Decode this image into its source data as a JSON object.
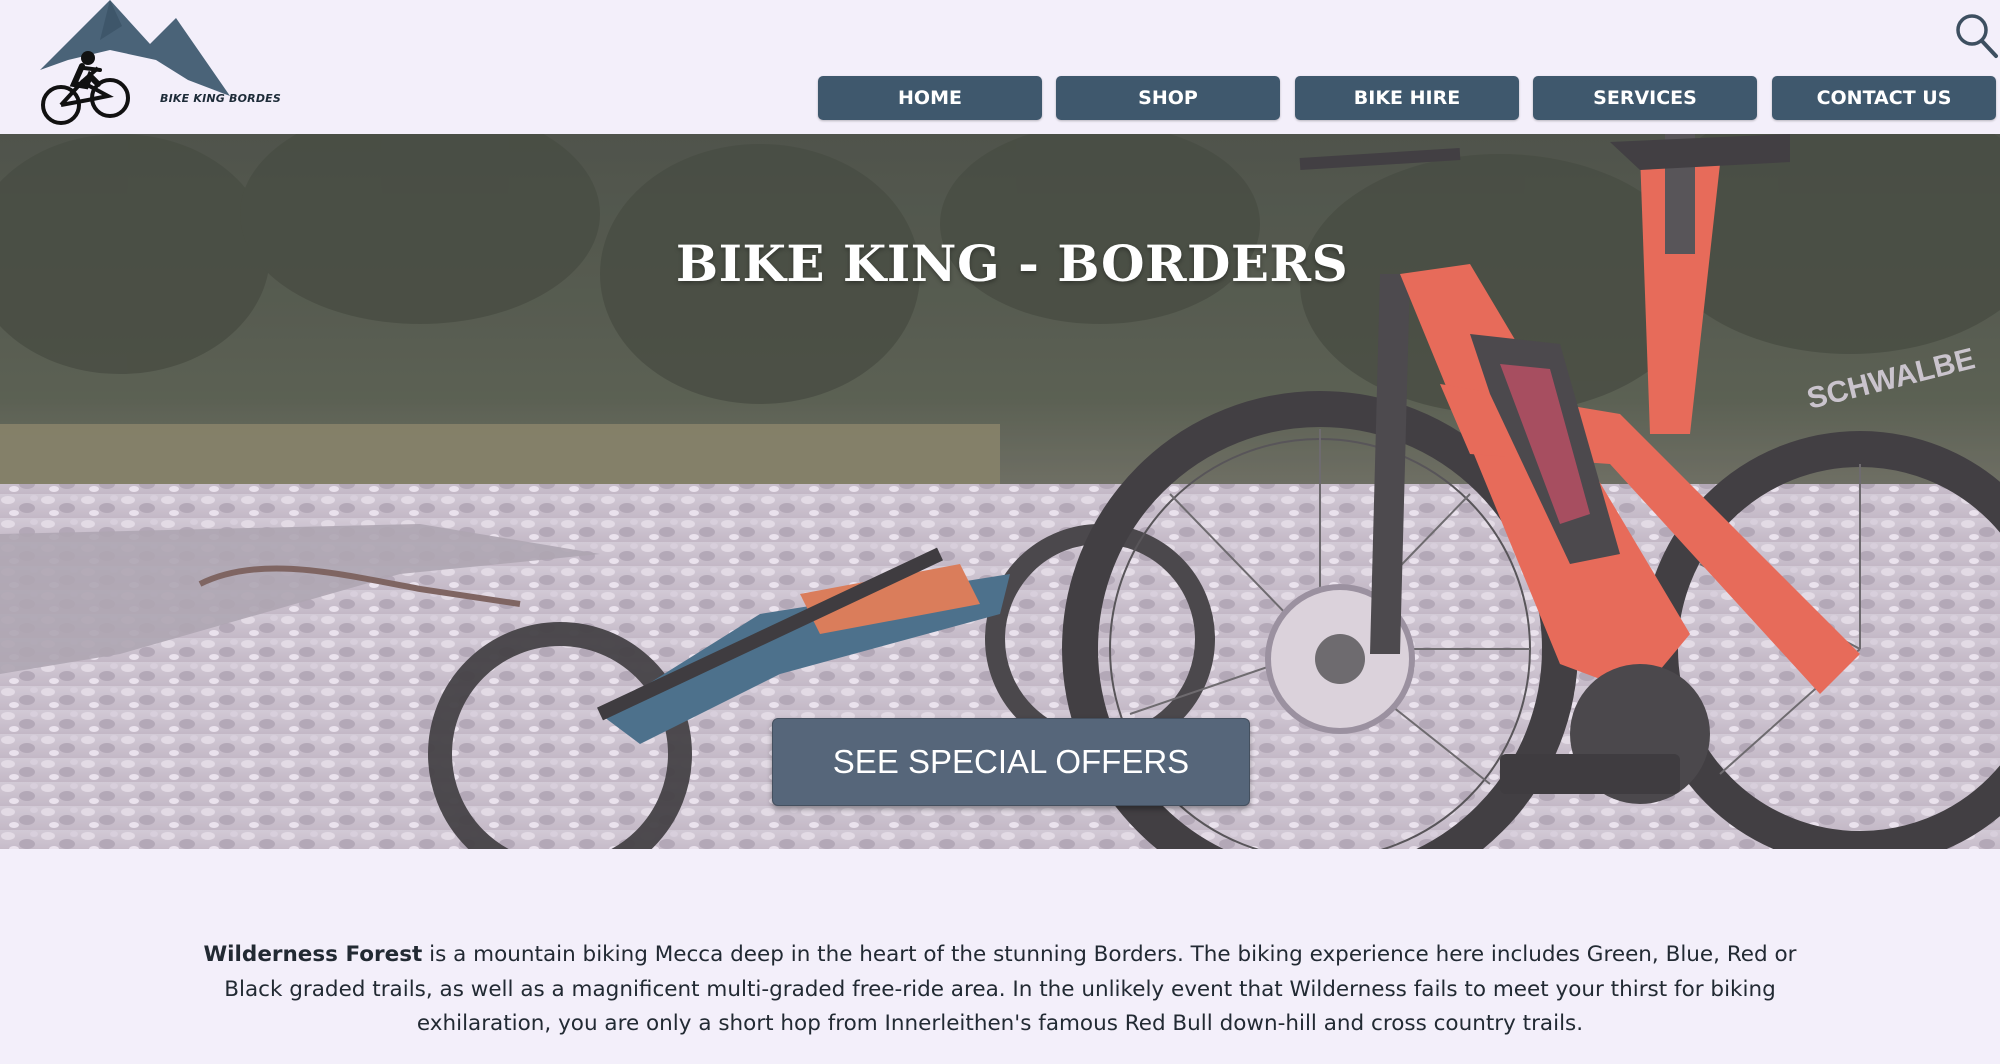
{
  "header": {
    "logo_text": "BIKE KING BORDES",
    "search_icon": "search-icon"
  },
  "nav": {
    "items": [
      {
        "label": "HOME"
      },
      {
        "label": "SHOP"
      },
      {
        "label": "BIKE HIRE"
      },
      {
        "label": "SERVICES"
      },
      {
        "label": "CONTACT US"
      }
    ]
  },
  "hero": {
    "title": "BIKE KING - BORDERS",
    "cta_label": "SEE SPECIAL OFFERS",
    "bike_brand_text": "SCHWALBE"
  },
  "intro": {
    "bold_lead": "Wilderness Forest",
    "text": " is a mountain biking Mecca deep in the heart of the stunning Borders. The biking experience here includes Green, Blue, Red or Black graded trails, as well as a magnificent multi-graded free-ride area. In the unlikely event that Wilderness fails to meet your thirst for biking exhilaration, you are only a short hop from Innerleithen's famous Red Bull down-hill and cross country trails."
  },
  "colors": {
    "page_bg": "#f3effa",
    "nav_bg": "#3f586d",
    "cta_bg": "#56667a",
    "logo_slate": "#4a6378",
    "bike_orange": "#e8553b"
  }
}
